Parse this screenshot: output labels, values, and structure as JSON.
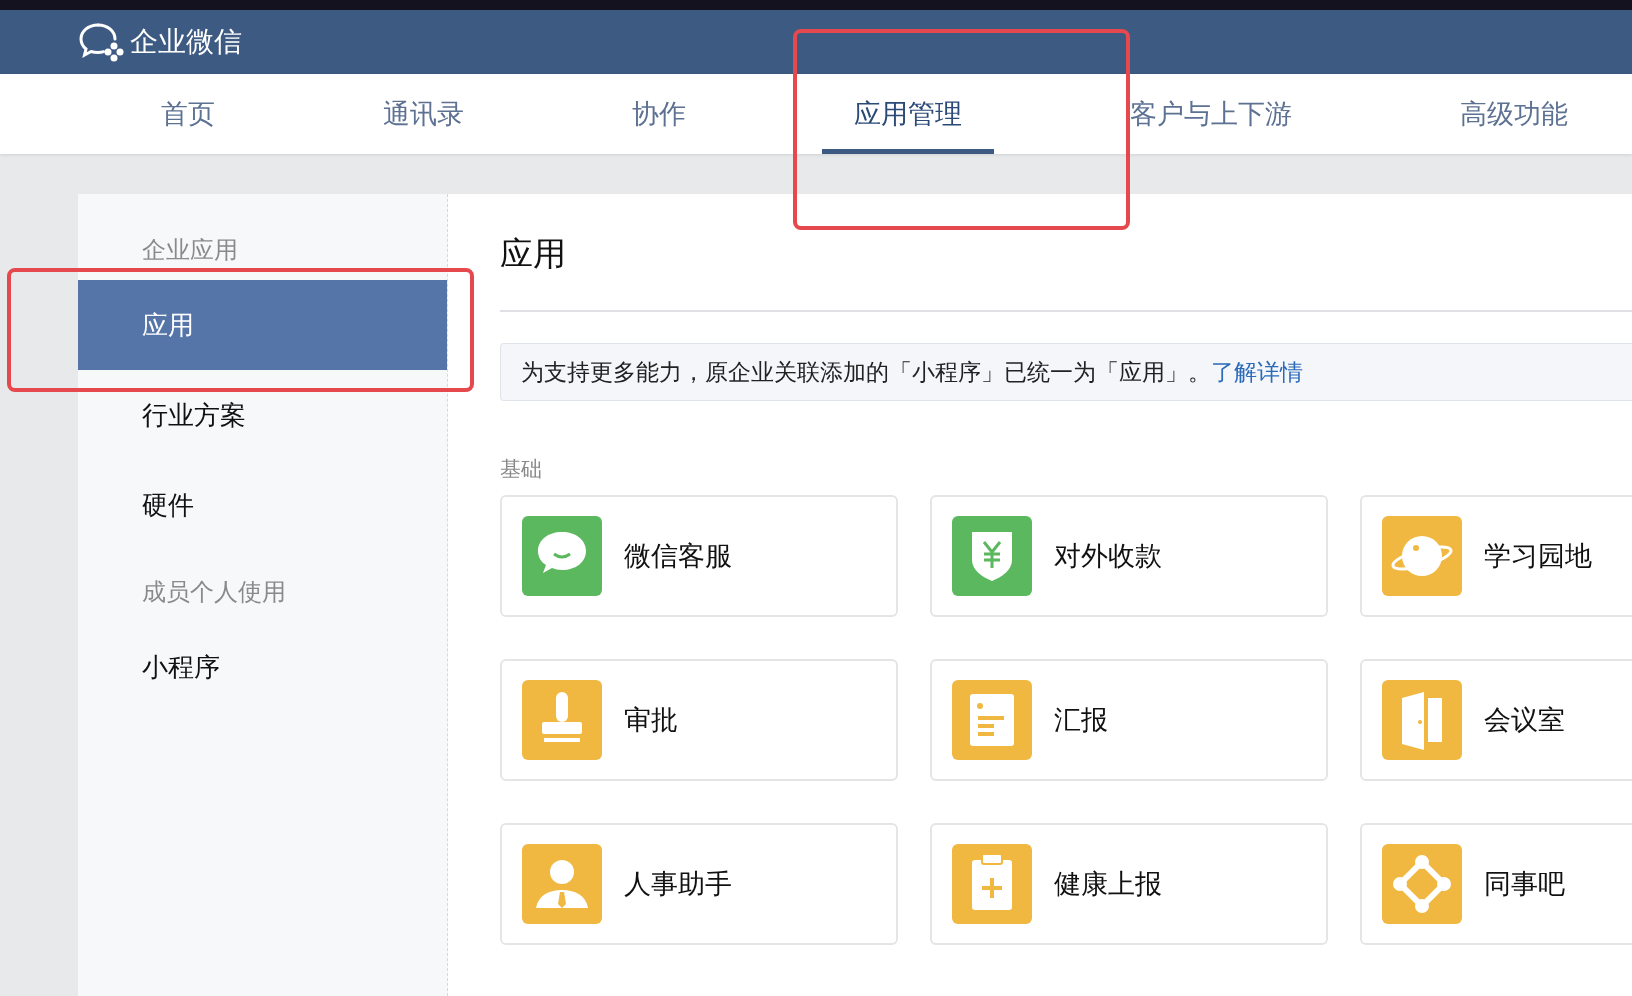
{
  "header": {
    "brand": "企业微信"
  },
  "nav": [
    {
      "label": "首页",
      "selected": false,
      "highlighted": false
    },
    {
      "label": "通讯录",
      "selected": false,
      "highlighted": false
    },
    {
      "label": "协作",
      "selected": false,
      "highlighted": false
    },
    {
      "label": "应用管理",
      "selected": true,
      "highlighted": true
    },
    {
      "label": "客户与上下游",
      "selected": false,
      "highlighted": false
    },
    {
      "label": "高级功能",
      "selected": false,
      "highlighted": false
    }
  ],
  "sidebar": [
    {
      "kind": "header",
      "label": "企业应用"
    },
    {
      "kind": "item",
      "label": "应用",
      "selected": true,
      "highlighted": true
    },
    {
      "kind": "item",
      "label": "行业方案",
      "selected": false,
      "highlighted": false
    },
    {
      "kind": "item",
      "label": "硬件",
      "selected": false,
      "highlighted": false
    },
    {
      "kind": "header",
      "label": "成员个人使用"
    },
    {
      "kind": "item",
      "label": "小程序",
      "selected": false,
      "highlighted": false
    }
  ],
  "main": {
    "title": "应用",
    "notice": {
      "text": "为支持更多能力，原企业关联添加的「小程序」已统一为「应用」。",
      "link": "了解详情"
    },
    "section": "基础",
    "apps": [
      {
        "name": "微信客服",
        "color": "#5cb85f"
      },
      {
        "name": "对外收款",
        "color": "#5cb85f"
      },
      {
        "name": "学习园地",
        "color": "#f0b841"
      },
      {
        "name": "审批",
        "color": "#f0b841"
      },
      {
        "name": "汇报",
        "color": "#f0b841"
      },
      {
        "name": "会议室",
        "color": "#f0b841"
      },
      {
        "name": "人事助手",
        "color": "#f0b841"
      },
      {
        "name": "健康上报",
        "color": "#f0b841"
      },
      {
        "name": "同事吧",
        "color": "#f0b841"
      }
    ]
  }
}
